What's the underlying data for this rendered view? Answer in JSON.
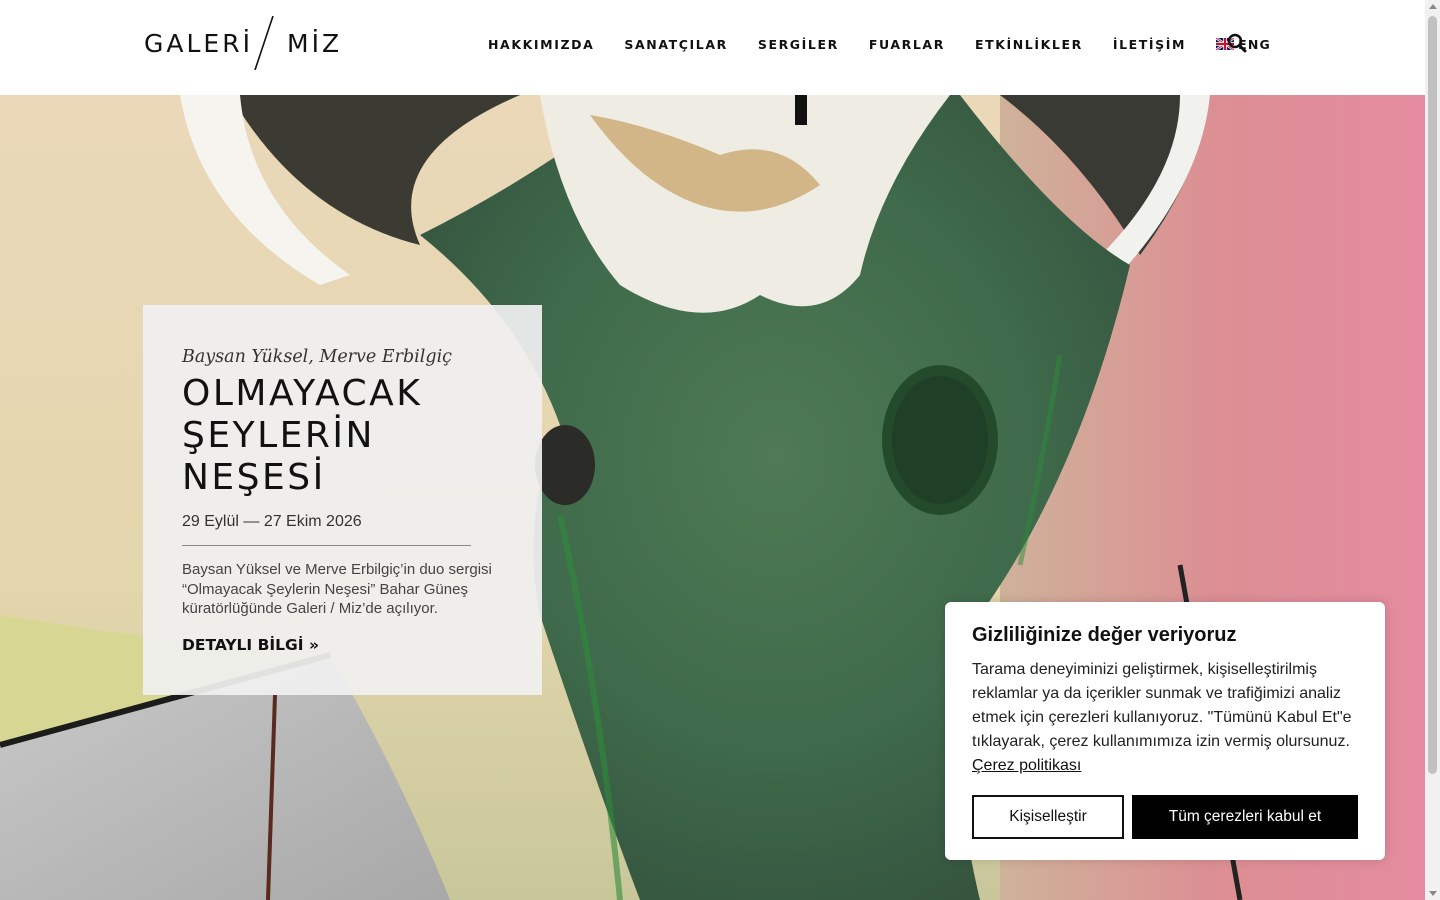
{
  "logo": {
    "left": "GALERİ",
    "right": "MİZ"
  },
  "nav": {
    "items": [
      "HAKKIMIZDA",
      "SANATÇILAR",
      "SERGİLER",
      "FUARLAR",
      "ETKİNLİKLER",
      "İLETİŞİM"
    ],
    "language": "ENG",
    "search_icon": "search-icon"
  },
  "exhibition": {
    "artists": "Baysan Yüksel, Merve Erbilgiç",
    "title_lines": [
      "OLMAYACAK",
      "ŞEYLERİN",
      "NEŞESİ"
    ],
    "dates": "29 Eylül — 27 Ekim 2026",
    "description": "Baysan Yüksel ve Merve Erbilgiç’in duo sergisi “Olmayacak Şeylerin Neşesi” Bahar Güneş küratörlüğünde Galeri / Miz’de açılıyor.",
    "link_label": "DETAYLI BİLGİ »"
  },
  "cookie": {
    "title": "Gizliliğinize değer veriyoruz",
    "text": "Tarama deneyiminizi geliştirmek, kişiselleştirilmiş reklamlar ya da içerikler sunmak ve trafiğimizi analiz etmek için çerezleri kullanıyoruz. \"Tümünü Kabul Et\"e tıklayarak, çerez kullanımımıza izin vermiş olursunuz.",
    "policy_link": "Çerez politikası",
    "customize_label": "Kişiselleştir",
    "accept_label": "Tüm çerezleri kabul et"
  }
}
